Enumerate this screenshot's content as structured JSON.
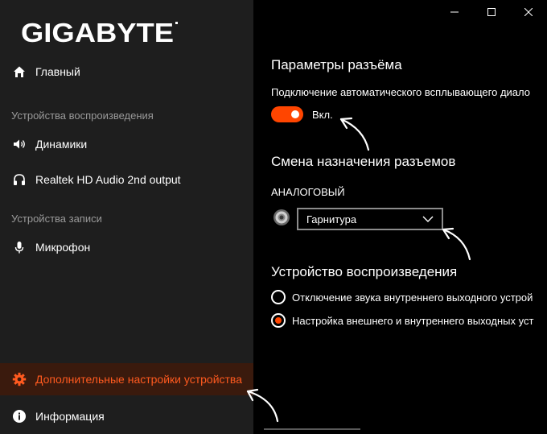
{
  "window": {
    "logo_text": "GIGABYTE",
    "controls": [
      "minimize-icon",
      "maximize-icon",
      "close-icon"
    ]
  },
  "sidebar": {
    "home": "Главный",
    "playback_section": "Устройства воспроизведения",
    "speakers": "Динамики",
    "realtek_output": "Realtek HD Audio 2nd output",
    "recording_section": "Устройства записи",
    "microphone": "Микрофон",
    "advanced_settings": "Дополнительные настройки устройства",
    "info": "Информация"
  },
  "main": {
    "jack_settings_title": "Параметры разъёма",
    "auto_popup_text": "Подключение автоматического всплывающего диало",
    "toggle_label": "Вкл.",
    "toggle_on": true,
    "reassign_title": "Смена назначения разъемов",
    "analog_label": "АНАЛОГОВЫЙ",
    "jack_selected": "Гарнитура",
    "playback_device_title": "Устройство воспроизведения",
    "radio_options": [
      {
        "label": "Отключение звука внутреннего выходного устрой",
        "checked": false
      },
      {
        "label": "Настройка внешнего и внутреннего выходных уст",
        "checked": true
      }
    ]
  },
  "colors": {
    "accent": "#ff4500",
    "active_label": "#ff5a1f",
    "sidebar_bg": "#1e1e1e",
    "main_bg": "#000000",
    "section_text": "#9a9a9a"
  }
}
